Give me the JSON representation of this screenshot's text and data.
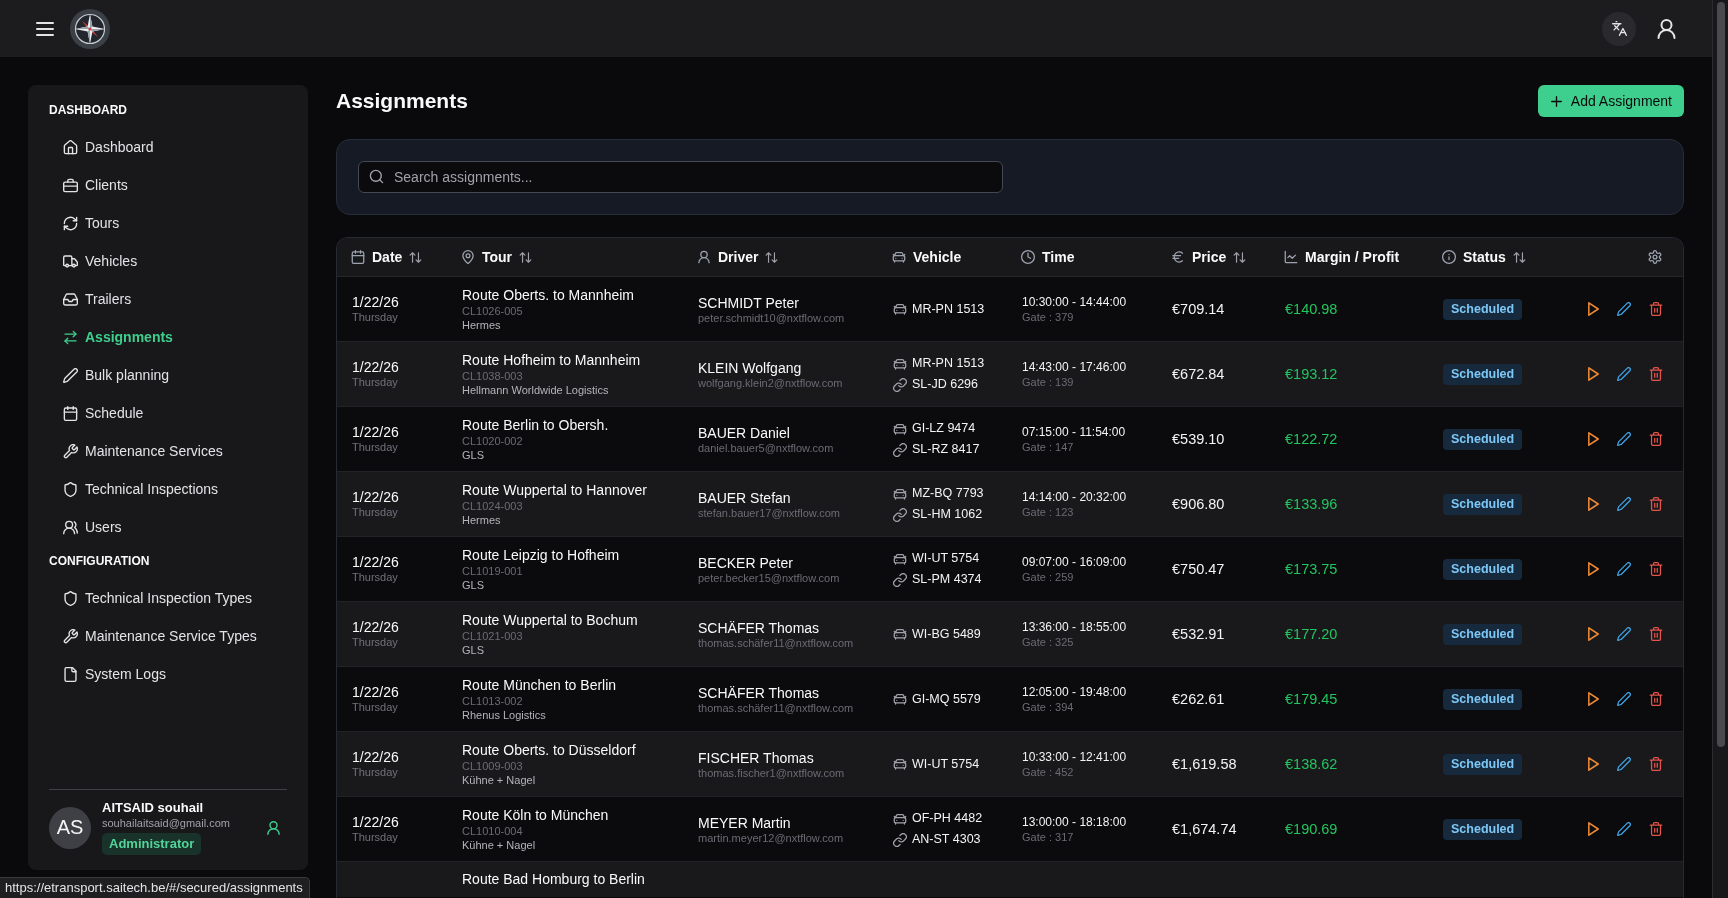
{
  "sidebar": {
    "sections": [
      {
        "heading": "DASHBOARD",
        "items": [
          {
            "label": "Dashboard",
            "selected": false
          },
          {
            "label": "Clients",
            "selected": false
          },
          {
            "label": "Tours",
            "selected": false
          },
          {
            "label": "Vehicles",
            "selected": false
          },
          {
            "label": "Trailers",
            "selected": false
          },
          {
            "label": "Assignments",
            "selected": true
          },
          {
            "label": "Bulk planning",
            "selected": false
          },
          {
            "label": "Schedule",
            "selected": false
          },
          {
            "label": "Maintenance Services",
            "selected": false
          },
          {
            "label": "Technical Inspections",
            "selected": false
          },
          {
            "label": "Users",
            "selected": false
          }
        ]
      },
      {
        "heading": "CONFIGURATION",
        "items": [
          {
            "label": "Technical Inspection Types",
            "selected": false
          },
          {
            "label": "Maintenance Service Types",
            "selected": false
          },
          {
            "label": "System Logs",
            "selected": false
          }
        ]
      }
    ],
    "user": {
      "initials": "AS",
      "name": "AITSAID souhail",
      "email": "souhailaitsaid@gmail.com",
      "role": "Administrator"
    }
  },
  "page": {
    "title": "Assignments",
    "add_button": "Add Assignment"
  },
  "search": {
    "placeholder": "Search assignments..."
  },
  "table": {
    "columns": [
      {
        "label": "Date",
        "sortable": true
      },
      {
        "label": "Tour",
        "sortable": true
      },
      {
        "label": "Driver",
        "sortable": true
      },
      {
        "label": "Vehicle",
        "sortable": false
      },
      {
        "label": "Time",
        "sortable": false
      },
      {
        "label": "Price",
        "sortable": true
      },
      {
        "label": "Margin / Profit",
        "sortable": false
      },
      {
        "label": "Status",
        "sortable": true
      }
    ],
    "rows": [
      {
        "date": "1/22/26",
        "weekday": "Thursday",
        "tour": "Route Oberts. to Mannheim",
        "code": "CL1026-005",
        "client": "Hermes",
        "driver": "SCHMIDT Peter",
        "email": "peter.schmidt10@nxtflow.com",
        "vehicles": [
          {
            "kind": "vehicle",
            "plate": "MR-PN 1513"
          }
        ],
        "time": "10:30:00 - 14:44:00",
        "gate": "Gate : 379",
        "price": "€709.14",
        "margin": "€140.98",
        "status": "Scheduled"
      },
      {
        "date": "1/22/26",
        "weekday": "Thursday",
        "tour": "Route Hofheim to Mannheim",
        "code": "CL1038-003",
        "client": "Hellmann Worldwide Logistics",
        "driver": "KLEIN Wolfgang",
        "email": "wolfgang.klein2@nxtflow.com",
        "vehicles": [
          {
            "kind": "vehicle",
            "plate": "MR-PN 1513"
          },
          {
            "kind": "trailer",
            "plate": "SL-JD 6296"
          }
        ],
        "time": "14:43:00 - 17:46:00",
        "gate": "Gate : 139",
        "price": "€672.84",
        "margin": "€193.12",
        "status": "Scheduled"
      },
      {
        "date": "1/22/26",
        "weekday": "Thursday",
        "tour": "Route Berlin to Obersh.",
        "code": "CL1020-002",
        "client": "GLS",
        "driver": "BAUER Daniel",
        "email": "daniel.bauer5@nxtflow.com",
        "vehicles": [
          {
            "kind": "vehicle",
            "plate": "GI-LZ 9474"
          },
          {
            "kind": "trailer",
            "plate": "SL-RZ 8417"
          }
        ],
        "time": "07:15:00 - 11:54:00",
        "gate": "Gate : 147",
        "price": "€539.10",
        "margin": "€122.72",
        "status": "Scheduled"
      },
      {
        "date": "1/22/26",
        "weekday": "Thursday",
        "tour": "Route Wuppertal to Hannover",
        "code": "CL1024-003",
        "client": "Hermes",
        "driver": "BAUER Stefan",
        "email": "stefan.bauer17@nxtflow.com",
        "vehicles": [
          {
            "kind": "vehicle",
            "plate": "MZ-BQ 7793"
          },
          {
            "kind": "trailer",
            "plate": "SL-HM 1062"
          }
        ],
        "time": "14:14:00 - 20:32:00",
        "gate": "Gate : 123",
        "price": "€906.80",
        "margin": "€133.96",
        "status": "Scheduled"
      },
      {
        "date": "1/22/26",
        "weekday": "Thursday",
        "tour": "Route Leipzig to Hofheim",
        "code": "CL1019-001",
        "client": "GLS",
        "driver": "BECKER Peter",
        "email": "peter.becker15@nxtflow.com",
        "vehicles": [
          {
            "kind": "vehicle",
            "plate": "WI-UT 5754"
          },
          {
            "kind": "trailer",
            "plate": "SL-PM 4374"
          }
        ],
        "time": "09:07:00 - 16:09:00",
        "gate": "Gate : 259",
        "price": "€750.47",
        "margin": "€173.75",
        "status": "Scheduled"
      },
      {
        "date": "1/22/26",
        "weekday": "Thursday",
        "tour": "Route Wuppertal to Bochum",
        "code": "CL1021-003",
        "client": "GLS",
        "driver": "SCHÄFER Thomas",
        "email": "thomas.schäfer11@nxtflow.com",
        "vehicles": [
          {
            "kind": "vehicle",
            "plate": "WI-BG 5489"
          }
        ],
        "time": "13:36:00 - 18:55:00",
        "gate": "Gate : 325",
        "price": "€532.91",
        "margin": "€177.20",
        "status": "Scheduled"
      },
      {
        "date": "1/22/26",
        "weekday": "Thursday",
        "tour": "Route München to Berlin",
        "code": "CL1013-002",
        "client": "Rhenus Logistics",
        "driver": "SCHÄFER Thomas",
        "email": "thomas.schäfer11@nxtflow.com",
        "vehicles": [
          {
            "kind": "vehicle",
            "plate": "GI-MQ 5579"
          }
        ],
        "time": "12:05:00 - 19:48:00",
        "gate": "Gate : 394",
        "price": "€262.61",
        "margin": "€179.45",
        "status": "Scheduled"
      },
      {
        "date": "1/22/26",
        "weekday": "Thursday",
        "tour": "Route Oberts. to Düsseldorf",
        "code": "CL1009-003",
        "client": "Kühne + Nagel",
        "driver": "FISCHER Thomas",
        "email": "thomas.fischer1@nxtflow.com",
        "vehicles": [
          {
            "kind": "vehicle",
            "plate": "WI-UT 5754"
          }
        ],
        "time": "10:33:00 - 12:41:00",
        "gate": "Gate : 452",
        "price": "€1,619.58",
        "margin": "€138.62",
        "status": "Scheduled"
      },
      {
        "date": "1/22/26",
        "weekday": "Thursday",
        "tour": "Route Köln to München",
        "code": "CL1010-004",
        "client": "Kühne + Nagel",
        "driver": "MEYER Martin",
        "email": "martin.meyer12@nxtflow.com",
        "vehicles": [
          {
            "kind": "vehicle",
            "plate": "OF-PH 4482"
          },
          {
            "kind": "trailer",
            "plate": "AN-ST 4303"
          }
        ],
        "time": "13:00:00 - 18:18:00",
        "gate": "Gate : 317",
        "price": "€1,674.74",
        "margin": "€190.69",
        "status": "Scheduled"
      },
      {
        "tour": "Route Bad Homburg to Berlin"
      }
    ]
  },
  "status_bar": {
    "url": "https://etransport.saitech.be/#/secured/assignments"
  }
}
